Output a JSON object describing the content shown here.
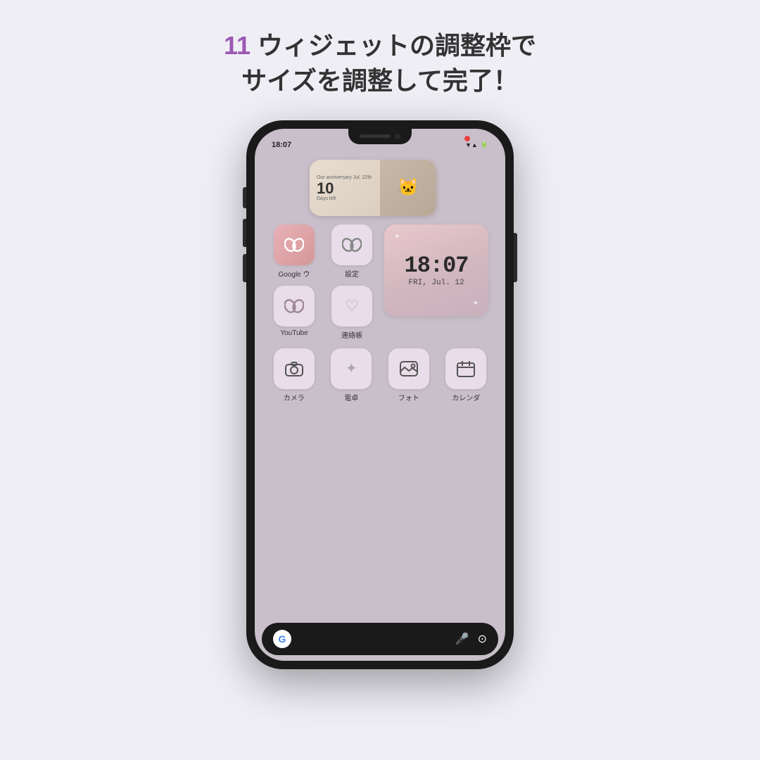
{
  "header": {
    "step_number": "11",
    "step_prefix": " ウィジェットの調整枠で",
    "step_line2": "サイズを調整して完了！"
  },
  "phone": {
    "status_bar": {
      "time": "18:07",
      "icons": "🔔 ⚙ ▼ 🔋"
    },
    "widget_anniversary": {
      "subtitle": "Our anniversary\nJul. 22th",
      "days": "10",
      "days_label": "Days left"
    },
    "clock_widget": {
      "time": "18:07",
      "date": "FRI, Jul. 12",
      "sparkle": "✦"
    },
    "apps": [
      {
        "id": "google",
        "label": "Google ウ",
        "icon": "🌐"
      },
      {
        "id": "settings",
        "label": "設定",
        "icon": "⚙"
      },
      {
        "id": "youtube",
        "label": "YouTube",
        "icon": "▶"
      },
      {
        "id": "contacts",
        "label": "連絡帳",
        "icon": "♡"
      },
      {
        "id": "camera",
        "label": "カメラ",
        "icon": "📷"
      },
      {
        "id": "calculator",
        "label": "電卓",
        "icon": "✦"
      },
      {
        "id": "photos",
        "label": "フォト",
        "icon": "🖼"
      },
      {
        "id": "calendar",
        "label": "カレンダ",
        "icon": "📅"
      }
    ],
    "search_bar": {
      "g_label": "G",
      "mic_icon": "🎤",
      "lens_icon": "🔍"
    }
  },
  "colors": {
    "header_number": "#9b59b6",
    "header_text": "#333333",
    "background": "#f0eef5",
    "phone_bg": "#c9bfca",
    "phone_shell": "#1a1a1a"
  }
}
